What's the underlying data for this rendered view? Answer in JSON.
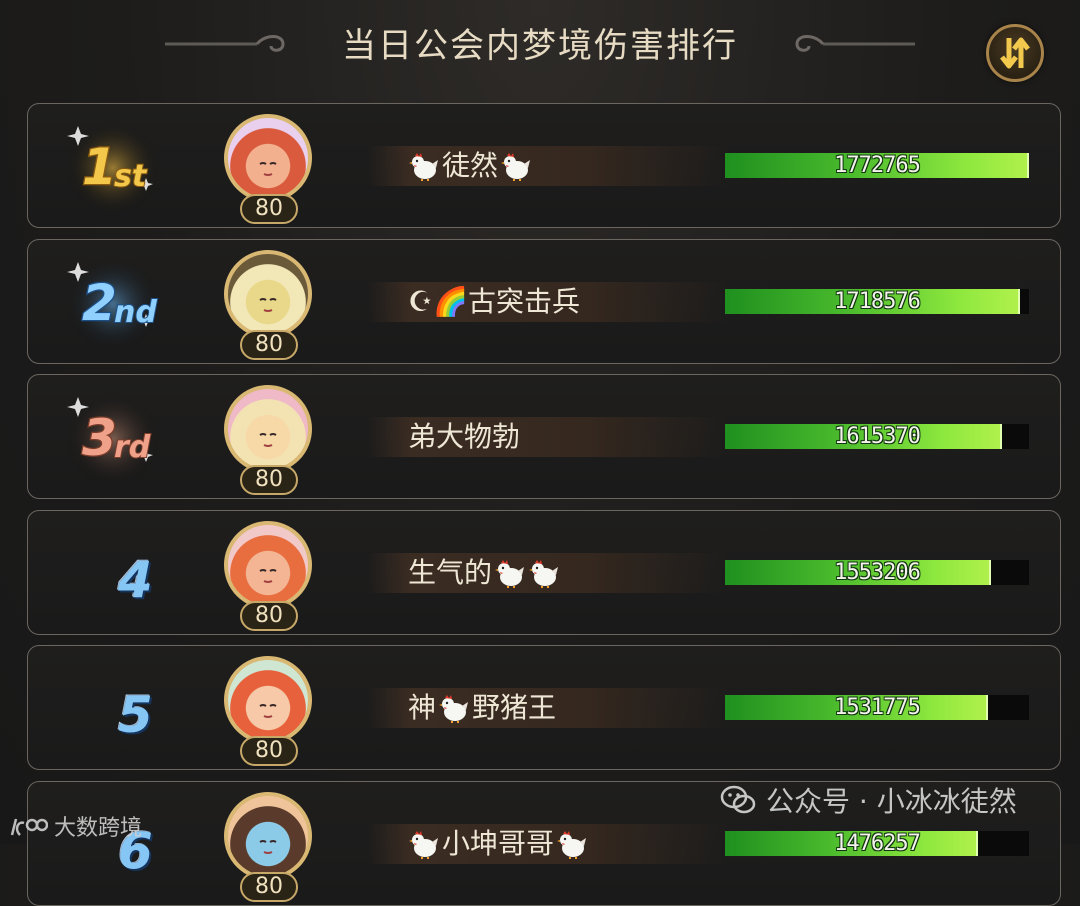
{
  "header": {
    "title": "当日公会内梦境伤害排行",
    "sort_button_icon": "sort-swap-icon"
  },
  "ranking": {
    "max_damage": 1772765,
    "rows": [
      {
        "rank_label": "1st",
        "rank_style": "gold",
        "level": "80",
        "name": "徒然",
        "name_prefix_icons": [
          "chicken-emoji"
        ],
        "name_suffix_icons": [
          "chicken-emoji"
        ],
        "damage": "1772765",
        "fill": 1.0
      },
      {
        "rank_label": "2nd",
        "rank_style": "silver-blue",
        "level": "80",
        "name": "☪🌈古突击兵",
        "name_prefix_icons": [],
        "name_suffix_icons": [],
        "damage": "1718576",
        "fill": 0.969
      },
      {
        "rank_label": "3rd",
        "rank_style": "bronze",
        "level": "80",
        "name": "弟大物勃",
        "name_prefix_icons": [],
        "name_suffix_icons": [],
        "damage": "1615370",
        "fill": 0.911
      },
      {
        "rank_label": "4",
        "rank_style": "plain",
        "level": "80",
        "name": "生气的",
        "name_prefix_icons": [],
        "name_suffix_icons": [
          "chicken-emoji",
          "chicken-emoji"
        ],
        "damage": "1553206",
        "fill": 0.876
      },
      {
        "rank_label": "5",
        "rank_style": "plain",
        "level": "80",
        "name": "神",
        "name_prefix_icons": [],
        "name_mid_icon": "chicken-emoji",
        "name_after": "野猪王",
        "name_suffix_icons": [],
        "damage": "1531775",
        "fill": 0.864
      },
      {
        "rank_label": "6",
        "rank_style": "plain",
        "level": "80",
        "name": "小坤哥哥",
        "name_prefix_icons": [
          "chicken-emoji"
        ],
        "name_suffix_icons": [
          "chicken-emoji"
        ],
        "damage": "1476257",
        "fill": 0.833
      }
    ]
  },
  "watermarks": {
    "right": "公众号 · 小冰冰徒然",
    "left": "大数跨境"
  },
  "colors": {
    "gold": "#f1c34a",
    "blue_rank": "#86c6f5",
    "bar_green": "#48b92c",
    "bar_lime": "#b0f04c",
    "border": "#6b665f"
  }
}
